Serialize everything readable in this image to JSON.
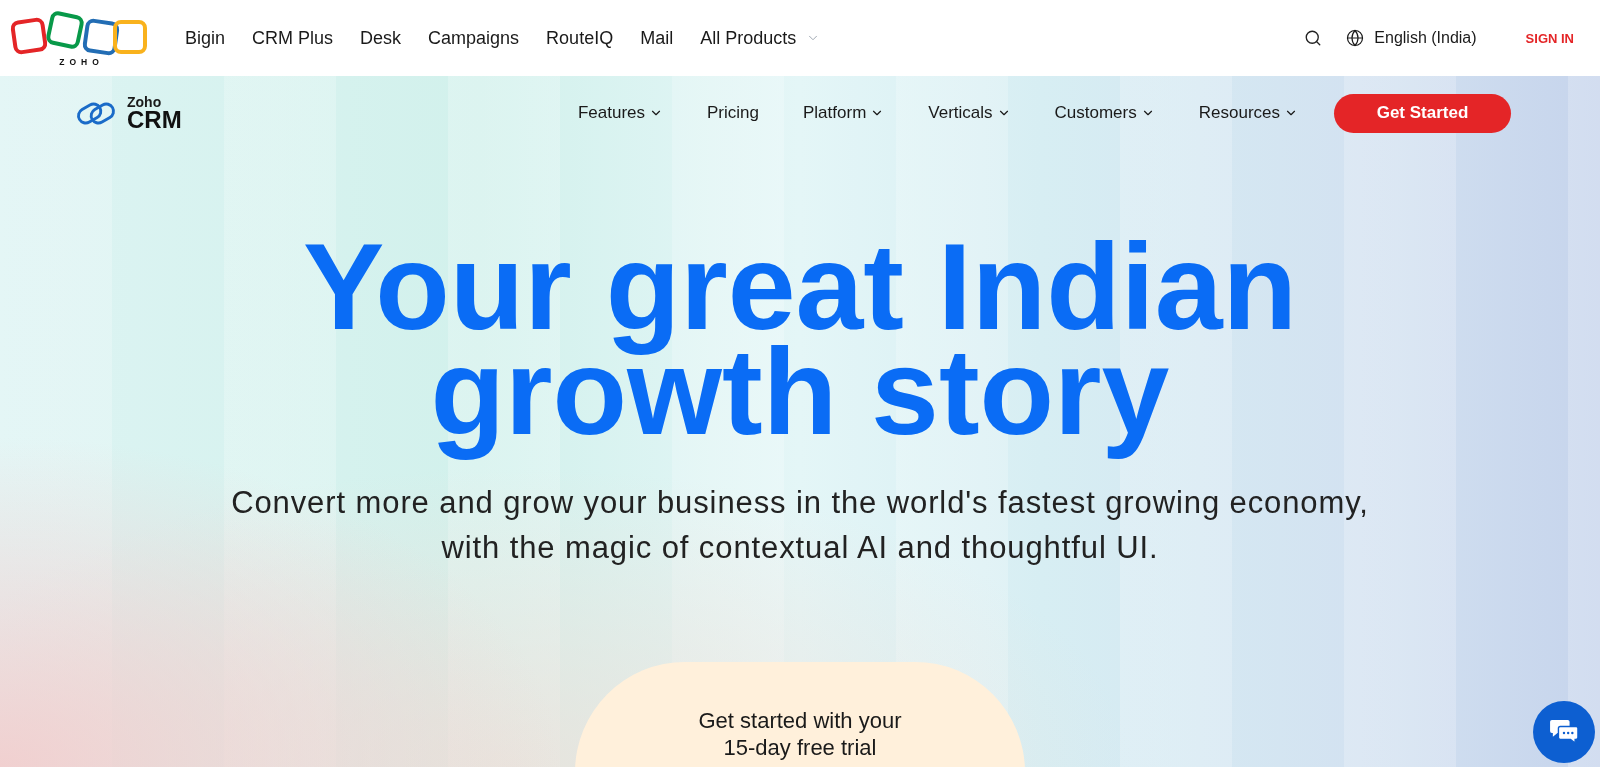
{
  "top_bar": {
    "logo_text": "ZOHO",
    "products": [
      {
        "label": "Bigin",
        "dropdown": false
      },
      {
        "label": "CRM Plus",
        "dropdown": false
      },
      {
        "label": "Desk",
        "dropdown": false
      },
      {
        "label": "Campaigns",
        "dropdown": false
      },
      {
        "label": "RouteIQ",
        "dropdown": false
      },
      {
        "label": "Mail",
        "dropdown": false
      },
      {
        "label": "All Products",
        "dropdown": true
      }
    ],
    "language": "English (India)",
    "sign_in": "SIGN IN"
  },
  "product_nav": {
    "logo": {
      "brand": "Zoho",
      "product": "CRM"
    },
    "items": [
      {
        "label": "Features",
        "dropdown": true
      },
      {
        "label": "Pricing",
        "dropdown": false
      },
      {
        "label": "Platform",
        "dropdown": true
      },
      {
        "label": "Verticals",
        "dropdown": true
      },
      {
        "label": "Customers",
        "dropdown": true
      },
      {
        "label": "Resources",
        "dropdown": true
      }
    ],
    "cta": "Get Started"
  },
  "hero": {
    "title": "Your great Indian growth story",
    "subtitle": "Convert more and grow your business in the world's fastest growing economy, with the magic of contextual AI and thoughtful UI.",
    "trial_card": {
      "text": "Get started with your 15-day free trial"
    }
  }
}
